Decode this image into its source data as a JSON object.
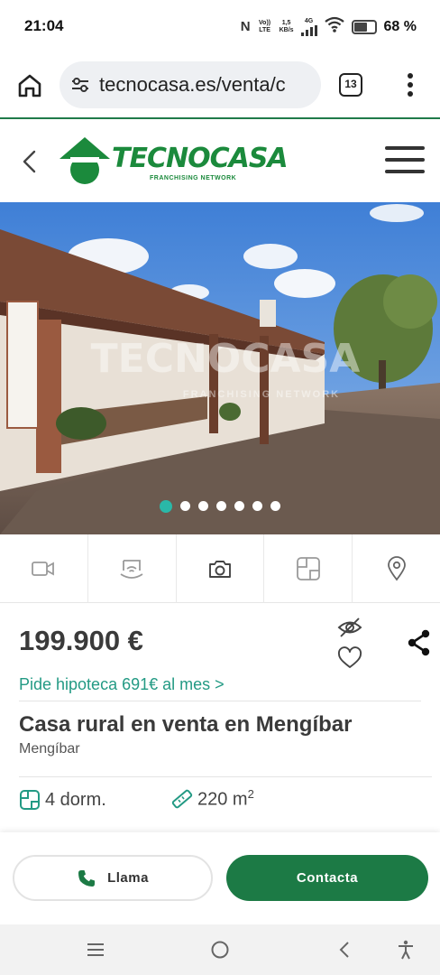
{
  "status_bar": {
    "time": "21:04",
    "nfc_label": "N",
    "volte_label": "Vo)) LTE",
    "speed_value": "1,5",
    "speed_unit": "KB/s",
    "network_label": "4G",
    "battery_percent": "68 %",
    "battery_level": 0.68
  },
  "browser": {
    "url": "tecnocasa.es/venta/c",
    "tab_count": "13",
    "icons": [
      "home-icon",
      "site-settings-icon",
      "tabs-icon",
      "more-vert-icon"
    ]
  },
  "site_header": {
    "logo_text": "TECNOCASA",
    "logo_subtext": "FRANCHISING NETWORK",
    "brand_color": "#1b8a3c"
  },
  "gallery": {
    "watermark_text": "TECNOCASA",
    "watermark_subtext": "FRANCHISING NETWORK",
    "image_count": 7,
    "active_index": 0,
    "active_color": "#2ab8a8"
  },
  "media_tabs": [
    {
      "icon": "video-icon"
    },
    {
      "icon": "virtual-tour-icon"
    },
    {
      "icon": "camera-icon"
    },
    {
      "icon": "floorplan-icon"
    },
    {
      "icon": "map-pin-icon"
    }
  ],
  "listing": {
    "price": "199.900 €",
    "mortgage_text": "Pide hipoteca 691€ al mes >",
    "title": "Casa rural en venta en Mengíbar",
    "location": "Mengíbar",
    "rooms": "4 dorm.",
    "area_value": "220 m",
    "area_unit_sup": "2",
    "accent_color": "#239a84"
  },
  "actions": {
    "call_label": "Llama",
    "contact_label": "Contacta",
    "contact_color": "#1c7a45"
  },
  "nav_bar": {
    "icons": [
      "recent-apps-icon",
      "home-circle-icon",
      "back-nav-icon",
      "accessibility-icon"
    ]
  }
}
